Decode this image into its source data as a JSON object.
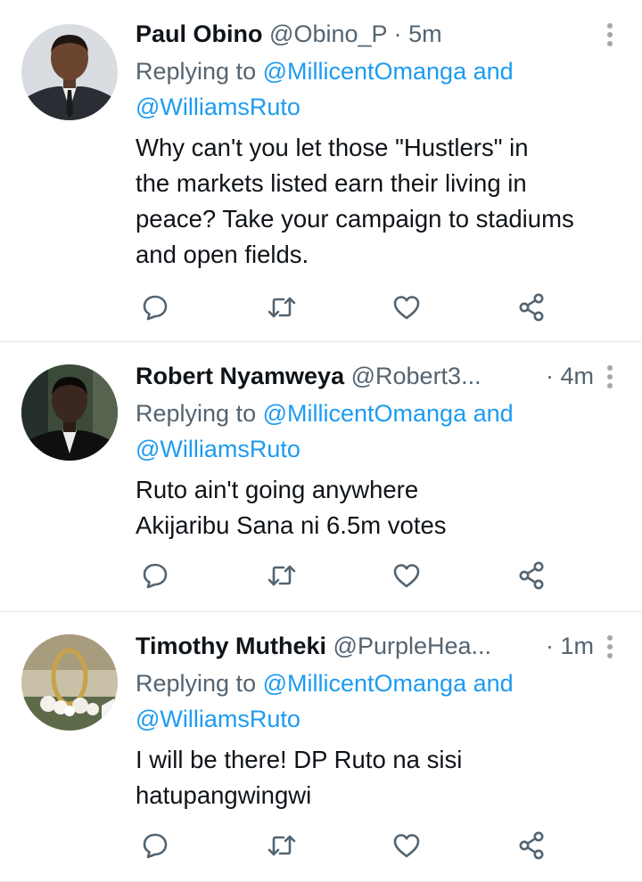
{
  "tweets": [
    {
      "name": "Paul Obino",
      "handle": "@Obino_P",
      "separator": "·",
      "time": "5m",
      "replying_prefix": "Replying to",
      "mention1": "@MillicentOmanga",
      "and": "and",
      "mention2": "@WilliamsRuto",
      "body_lines": [
        "Why can't you let those \"Hustlers\" in",
        "the markets listed earn their living in",
        "peace? Take your campaign to stadiums",
        "and open fields."
      ]
    },
    {
      "name": "Robert Nyamweya",
      "handle": "@Robert3...",
      "separator": "·",
      "time": "4m",
      "replying_prefix": "Replying to",
      "mention1": "@MillicentOmanga",
      "and": "and",
      "mention2": "@WilliamsRuto",
      "body_lines": [
        "Ruto ain't going anywhere",
        "Akijaribu Sana ni 6.5m votes"
      ]
    },
    {
      "name": "Timothy Mutheki",
      "handle": "@PurpleHea...",
      "separator": "·",
      "time": "1m",
      "replying_prefix": "Replying to",
      "mention1": "@MillicentOmanga",
      "and": "and",
      "mention2": "@WilliamsRuto",
      "body_lines": [
        "I will be there! DP Ruto na sisi",
        "hatupangwingwi"
      ]
    }
  ],
  "icons": [
    "comment-icon",
    "retweet-icon",
    "like-icon",
    "share-icon",
    "more-options-icon"
  ],
  "colors": {
    "mention": "#1d9bf0",
    "secondary_text": "#536471",
    "icon": "#536471"
  }
}
